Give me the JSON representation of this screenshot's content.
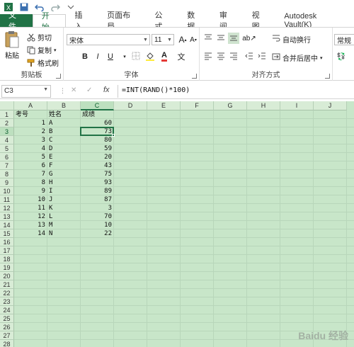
{
  "tabs": [
    "文件",
    "开始",
    "插入",
    "页面布局",
    "公式",
    "数据",
    "审阅",
    "视图",
    "Autodesk Vault(K)"
  ],
  "clipboard": {
    "paste_label": "粘贴",
    "cut_label": "剪切",
    "copy_label": "复制",
    "format_painter_label": "格式刷",
    "group_label": "剪贴板"
  },
  "font": {
    "font_name": "宋体",
    "font_size": "11",
    "grow_label": "A",
    "shrink_label": "A",
    "bold": "B",
    "italic": "I",
    "underline": "U",
    "font_color_label": "A",
    "phonetic_label": "文",
    "group_label": "字体"
  },
  "alignment": {
    "wrap_text_label": "自动换行",
    "merge_center_label": "合并后居中",
    "group_label": "对齐方式"
  },
  "number": {
    "format_value": "常规"
  },
  "formula_bar": {
    "name_box": "C3",
    "cancel": "✕",
    "enter": "✓",
    "fx": "fx",
    "formula": "=INT(RAND()*100)"
  },
  "sheet": {
    "columns": [
      "A",
      "B",
      "C",
      "D",
      "E",
      "F",
      "G",
      "H",
      "I",
      "J"
    ],
    "selected_column": "C",
    "selected_row": 3,
    "row_count": 28,
    "header": {
      "a": "考号",
      "b": "姓名",
      "c": "成绩"
    },
    "rows": [
      {
        "a": "1",
        "b": "A",
        "c": "60"
      },
      {
        "a": "2",
        "b": "B",
        "c": "73"
      },
      {
        "a": "3",
        "b": "C",
        "c": "80"
      },
      {
        "a": "4",
        "b": "D",
        "c": "59"
      },
      {
        "a": "5",
        "b": "E",
        "c": "20"
      },
      {
        "a": "6",
        "b": "F",
        "c": "43"
      },
      {
        "a": "7",
        "b": "G",
        "c": "75"
      },
      {
        "a": "8",
        "b": "H",
        "c": "93"
      },
      {
        "a": "9",
        "b": "I",
        "c": "89"
      },
      {
        "a": "10",
        "b": "J",
        "c": "87"
      },
      {
        "a": "11",
        "b": "K",
        "c": "3"
      },
      {
        "a": "12",
        "b": "L",
        "c": "70"
      },
      {
        "a": "13",
        "b": "M",
        "c": "10"
      },
      {
        "a": "14",
        "b": "N",
        "c": "22"
      }
    ]
  },
  "watermark": "Baidu 经验",
  "colors": {
    "accent": "#217346",
    "grid_bg": "#c8e6c9"
  }
}
